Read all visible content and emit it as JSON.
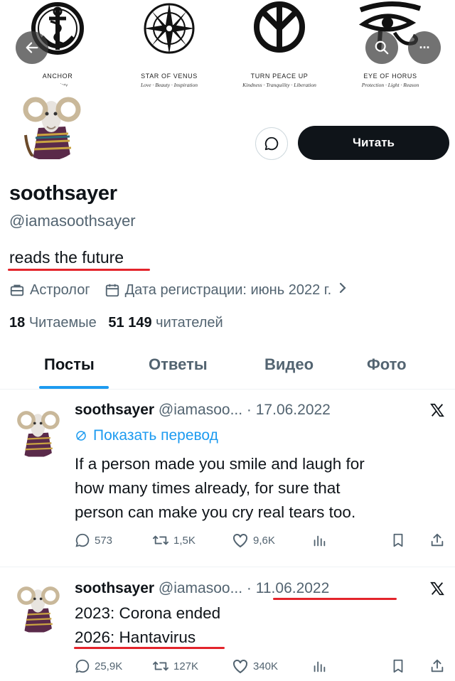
{
  "banner": {
    "symbols": [
      {
        "name": "ANCHOR",
        "subtitle": "Certainty"
      },
      {
        "name": "STAR OF VENUS",
        "subtitle": "Love · Beauty · Inspiration"
      },
      {
        "name": "TURN PEACE UP",
        "subtitle": "Kindness · Tranquility · Liberation"
      },
      {
        "name": "EYE OF HORUS",
        "subtitle": "Protection · Light · Reason"
      }
    ]
  },
  "nav": {
    "back_icon": "arrow-left-icon",
    "search_icon": "search-icon",
    "more_icon": "more-dots-icon",
    "more_label": "···"
  },
  "profile": {
    "display_name": "soothsayer",
    "handle": "@iamasoothsayer",
    "bio": "reads the future",
    "category": "Астролог",
    "joined": "Дата регистрации: июнь 2022 г.",
    "following_count": "18",
    "following_label": "Читаемые",
    "followers_count": "51 149",
    "followers_label": "читателей",
    "follow_button": "Читать"
  },
  "tabs": [
    "Посты",
    "Ответы",
    "Видео",
    "Фото"
  ],
  "active_tab": "Посты",
  "tweets": [
    {
      "name": "soothsayer",
      "handle_date": "@iamasoo... · 17.06.2022",
      "translate": "Показать перевод",
      "text_lines": [
        "If a person made you smile and laugh for",
        "how many times already, for sure that",
        "person can make you cry real tears too."
      ],
      "replies": "573",
      "retweets": "1,5K",
      "likes": "9,6K"
    },
    {
      "name": "soothsayer",
      "handle_date": "@iamasoo... · 11.06.2022",
      "text_lines": [
        "2023: Corona ended",
        "2026: Hantavirus"
      ],
      "replies": "25,9K",
      "retweets": "127K",
      "likes": "340K"
    }
  ],
  "colors": {
    "accent": "#1d9bf0",
    "text": "#0f1419",
    "secondary": "#536471",
    "highlight_underline": "#e3242b",
    "button_dark": "#0f1419"
  }
}
